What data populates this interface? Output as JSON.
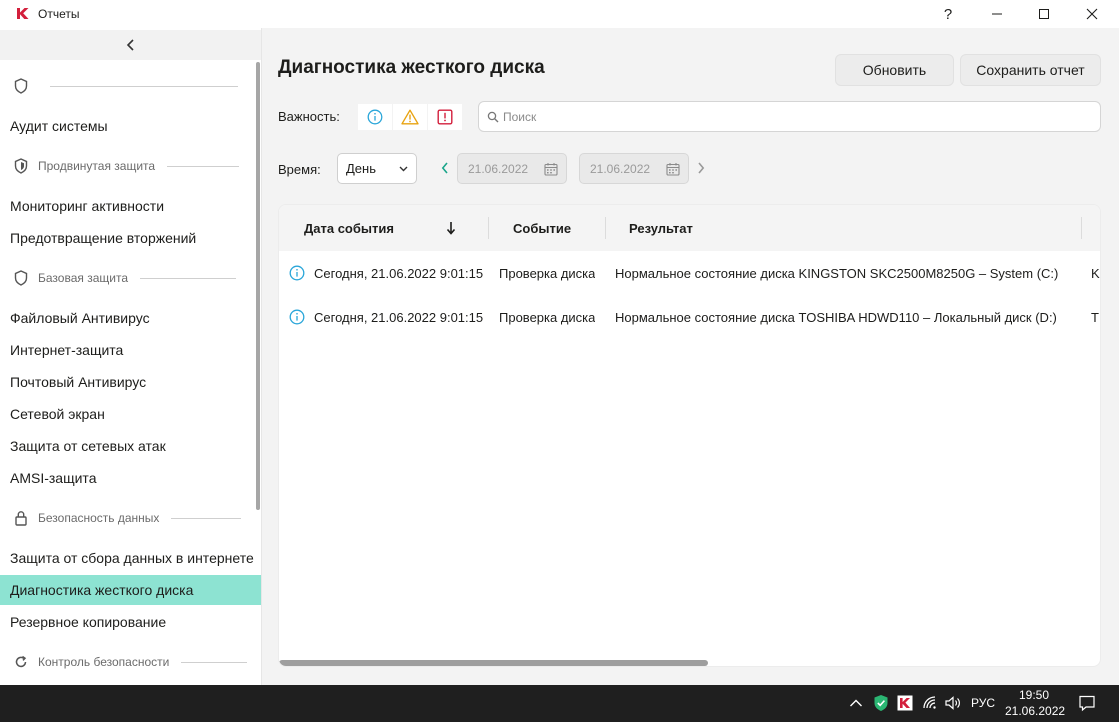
{
  "app": {
    "title": "Отчеты",
    "help_symbol": "?"
  },
  "sidebar": {
    "groups": [
      {
        "label": ""
      },
      {
        "label": "Продвинутая защита"
      },
      {
        "label": "Базовая защита"
      },
      {
        "label": "Безопасность данных"
      },
      {
        "label": "Контроль безопасности"
      }
    ],
    "items": [
      {
        "label": "Аудит системы"
      },
      {
        "label": "Мониторинг активности"
      },
      {
        "label": "Предотвращение вторжений"
      },
      {
        "label": "Файловый Антивирус"
      },
      {
        "label": "Интернет-защита"
      },
      {
        "label": "Почтовый Антивирус"
      },
      {
        "label": "Сетевой экран"
      },
      {
        "label": "Защита от сетевых атак"
      },
      {
        "label": "AMSI-защита"
      },
      {
        "label": "Защита от сбора данных в интернете"
      },
      {
        "label": "Диагностика жесткого диска"
      },
      {
        "label": "Резервное копирование"
      }
    ],
    "active_item": "Диагностика жесткого диска"
  },
  "main": {
    "title": "Диагностика жесткого диска",
    "refresh_label": "Обновить",
    "save_label": "Сохранить отчет",
    "severity_label": "Важность:",
    "search_placeholder": "Поиск",
    "time_label": "Время:",
    "period_value": "День",
    "date_from": "21.06.2022",
    "date_to": "21.06.2022"
  },
  "table": {
    "columns": [
      "Дата события",
      "Событие",
      "Результат"
    ],
    "sort_icon": "arrow-down-icon",
    "rows": [
      {
        "date": "Сегодня, 21.06.2022 9:01:15",
        "event": "Проверка диска",
        "result": "Нормальное состояние диска KINGSTON SKC2500M8250G – System (C:)",
        "extra": "K"
      },
      {
        "date": "Сегодня, 21.06.2022 9:01:15",
        "event": "Проверка диска",
        "result": "Нормальное состояние диска TOSHIBA HDWD110 – Локальный диск (D:)",
        "extra": "T"
      }
    ]
  },
  "taskbar": {
    "language": "РУС",
    "time": "19:50",
    "date": "21.06.2022"
  },
  "colors": {
    "active_item": "#8de3d2",
    "info": "#2aa6d9",
    "warning": "#e8a311",
    "critical": "#d31f3c",
    "brand_red": "#d31f3c"
  }
}
